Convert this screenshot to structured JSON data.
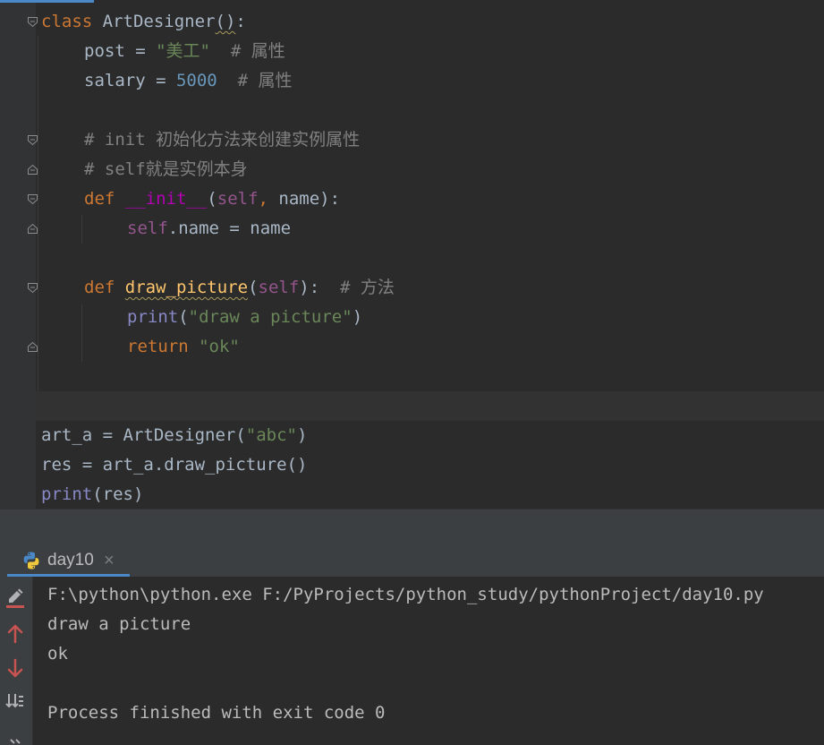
{
  "editor": {
    "lines": {
      "l1": {
        "kw": "class",
        "name": "ArtDesigner",
        "paren": "()",
        "colon": ":"
      },
      "l2": {
        "var": "post",
        "eq": " = ",
        "str": "\"美工\"",
        "comment": "  # 属性"
      },
      "l3": {
        "var": "salary",
        "eq": " = ",
        "num": "5000",
        "comment": "  # 属性"
      },
      "l5": {
        "comment": "# init 初始化方法来创建实例属性"
      },
      "l6": {
        "comment": "# self就是实例本身"
      },
      "l7": {
        "kw": "def",
        "fn": "__init__",
        "open": "(",
        "self": "self",
        "comma": ", ",
        "param": "name",
        "close": "):"
      },
      "l8": {
        "self": "self",
        "rest": ".name = name"
      },
      "l10": {
        "kw": "def",
        "fn": "draw_picture",
        "open": "(",
        "self": "self",
        "close": "):",
        "comment": "  # 方法"
      },
      "l11": {
        "builtin": "print",
        "open": "(",
        "str": "\"draw a picture\"",
        "close": ")"
      },
      "l12": {
        "kw": "return",
        "str": "\"ok\""
      },
      "l15": {
        "pre": "art_a = ArtDesigner(",
        "str": "\"abc\"",
        "post": ")"
      },
      "l16": {
        "text": "res = art_a.draw_picture()"
      },
      "l17": {
        "builtin": "print",
        "rest": "(res)"
      }
    }
  },
  "run_panel": {
    "tab_label": "day10",
    "tab_close": "×",
    "icons": [
      "python-icon",
      "edit-icon",
      "arrow-up-icon",
      "arrow-down-icon",
      "soft-wrap-icon"
    ],
    "output": {
      "command": "F:\\python\\python.exe F:/PyProjects/python_study/pythonProject/day10.py",
      "line1": "draw a picture",
      "line2": "ok",
      "line3": "",
      "exit": "Process finished with exit code 0"
    }
  },
  "colors": {
    "background": "#2b2b2b",
    "keyword": "#cc7832",
    "string": "#6a8759",
    "number": "#6897bb",
    "comment": "#808080",
    "self": "#94558d",
    "function": "#ffc66d",
    "accent": "#4a88c7"
  }
}
